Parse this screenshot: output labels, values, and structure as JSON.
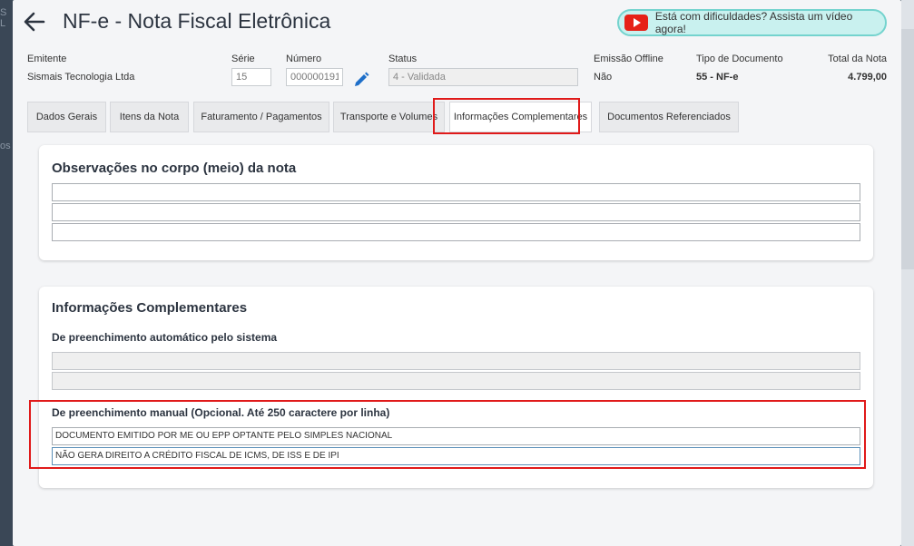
{
  "header": {
    "title": "NF-e - Nota Fiscal Eletrônica",
    "video_button_label": "Está com dificuldades? Assista um vídeo agora!"
  },
  "meta": {
    "emitente": {
      "label": "Emitente",
      "value": "Sismais Tecnologia Ltda"
    },
    "serie": {
      "label": "Série",
      "value": "15"
    },
    "numero": {
      "label": "Número",
      "value": "000000191"
    },
    "status": {
      "label": "Status",
      "value": "4 - Validada"
    },
    "emissao_offline": {
      "label": "Emissão Offline",
      "value": "Não"
    },
    "tipo_documento": {
      "label": "Tipo de Documento",
      "value": "55 - NF-e"
    },
    "total": {
      "label": "Total da Nota",
      "value": "4.799,00"
    }
  },
  "tabs": [
    {
      "label": "Dados Gerais"
    },
    {
      "label": "Itens da Nota"
    },
    {
      "label": "Faturamento / Pagamentos"
    },
    {
      "label": "Transporte e Volumes"
    },
    {
      "label": "Informações Complementares"
    },
    {
      "label": "Documentos Referenciados"
    }
  ],
  "observacoes": {
    "title": "Observações no corpo (meio) da nota",
    "lines": [
      "",
      "",
      ""
    ]
  },
  "info_complementares": {
    "title": "Informações Complementares",
    "auto_title": "De preenchimento automático pelo sistema",
    "auto_lines": [
      "",
      ""
    ],
    "manual_title": "De preenchimento manual (Opcional. Até 250 caractere por linha)",
    "manual_lines": [
      "DOCUMENTO EMITIDO POR ME OU EPP OPTANTE PELO SIMPLES NACIONAL",
      "NÃO GERA DIREITO A CRÉDITO FISCAL DE ICMS, DE ISS E DE IPI"
    ]
  },
  "colors": {
    "highlight": "#e01a1a",
    "accent_blue": "#1e6fc9",
    "video_bg": "#c9f1ef",
    "youtube_red": "#e62117"
  }
}
